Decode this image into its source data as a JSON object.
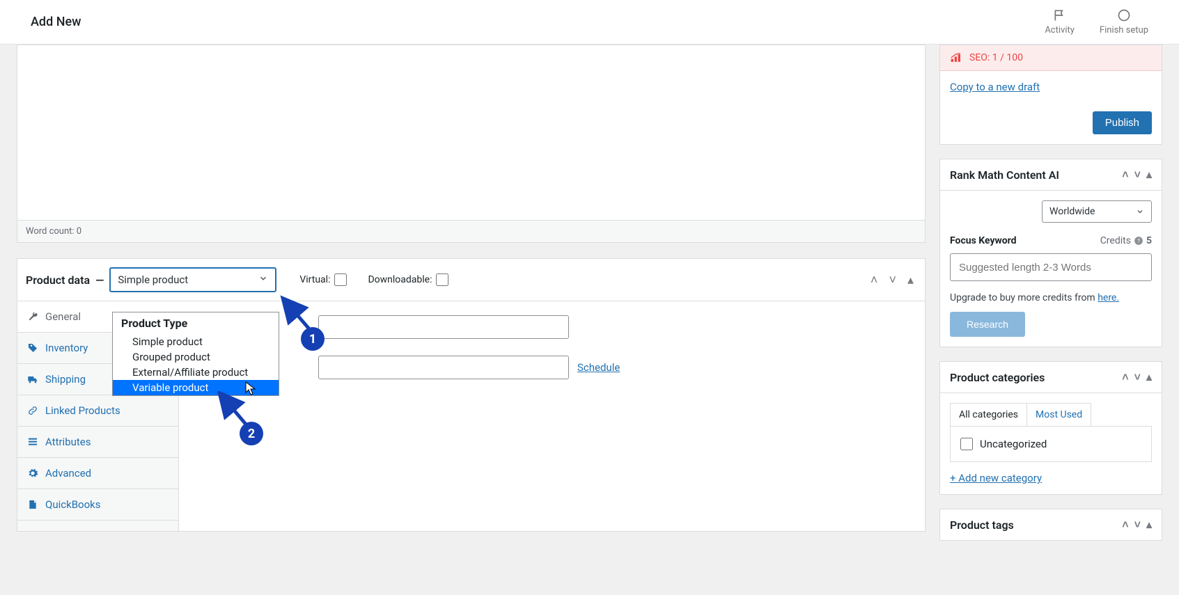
{
  "header": {
    "title": "Add New",
    "activity_label": "Activity",
    "finish_setup_label": "Finish setup"
  },
  "editor": {
    "word_count": "Word count: 0"
  },
  "product_data": {
    "title": "Product data",
    "dash": " — ",
    "selected": "Simple product",
    "virtual_label": "Virtual:",
    "downloadable_label": "Downloadable:",
    "dropdown_group_label": "Product Type",
    "options": {
      "simple": "Simple product",
      "grouped": "Grouped product",
      "external": "External/Affiliate product",
      "variable": "Variable product"
    },
    "tabs": {
      "general": "General",
      "inventory": "Inventory",
      "shipping": "Shipping",
      "linked": "Linked Products",
      "attributes": "Attributes",
      "advanced": "Advanced",
      "quickbooks": "QuickBooks"
    },
    "schedule": "Schedule",
    "annotations": {
      "one": "1",
      "two": "2"
    }
  },
  "sidebar": {
    "publish": {
      "seo_label": "SEO: 1 / 100",
      "copy_link": "Copy to a new draft",
      "publish_button": "Publish"
    },
    "rankmath": {
      "title": "Rank Math Content AI",
      "scope": "Worldwide",
      "focus_label": "Focus Keyword",
      "credits_label": "Credits",
      "credits_value": "5",
      "placeholder": "Suggested length 2-3 Words",
      "upgrade_text": "Upgrade to buy more credits from ",
      "upgrade_link": "here.",
      "research_button": "Research"
    },
    "categories": {
      "title": "Product categories",
      "tab_all": "All categories",
      "tab_most_used": "Most Used",
      "uncategorized": "Uncategorized",
      "add_new": "+ Add new category"
    },
    "tags": {
      "title": "Product tags"
    }
  }
}
